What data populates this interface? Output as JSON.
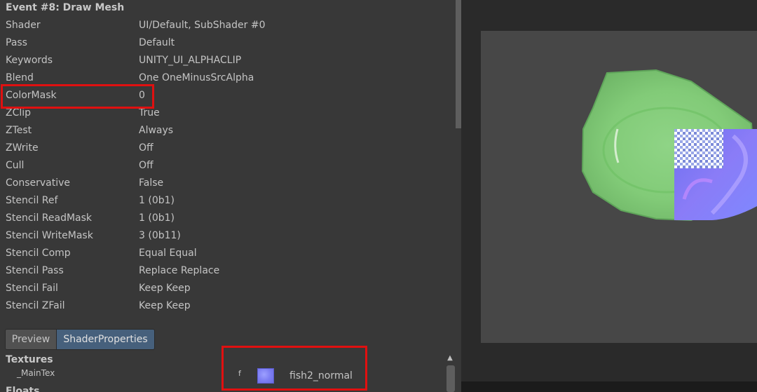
{
  "event_title": "Event #8: Draw Mesh",
  "properties": [
    {
      "key": "Shader",
      "value": "UI/Default, SubShader #0"
    },
    {
      "key": "Pass",
      "value": "Default"
    },
    {
      "key": "Keywords",
      "value": "UNITY_UI_ALPHACLIP"
    },
    {
      "key": "Blend",
      "value": "One OneMinusSrcAlpha"
    },
    {
      "key": "ColorMask",
      "value": "0"
    },
    {
      "key": "ZClip",
      "value": "True"
    },
    {
      "key": "ZTest",
      "value": "Always"
    },
    {
      "key": "ZWrite",
      "value": "Off"
    },
    {
      "key": "Cull",
      "value": "Off"
    },
    {
      "key": "Conservative",
      "value": "False"
    },
    {
      "key": "Stencil Ref",
      "value": "1 (0b1)"
    },
    {
      "key": "Stencil ReadMask",
      "value": "1 (0b1)"
    },
    {
      "key": "Stencil WriteMask",
      "value": "3 (0b11)"
    },
    {
      "key": "Stencil Comp",
      "value": "Equal Equal"
    },
    {
      "key": "Stencil Pass",
      "value": "Replace Replace"
    },
    {
      "key": "Stencil Fail",
      "value": "Keep Keep"
    },
    {
      "key": "Stencil ZFail",
      "value": "Keep Keep"
    }
  ],
  "tabs": {
    "preview": "Preview",
    "shader_properties": "ShaderProperties"
  },
  "textures": {
    "title": "Textures",
    "name": "_MainTex",
    "stage": "f",
    "value": "fish2_normal"
  },
  "floats_title": "Floats",
  "colors": {
    "highlight_box": "#e01010",
    "active_tab": "#46607c",
    "plate_green": "#86cf7c",
    "normal_map_blue": "#7b7cf2"
  }
}
